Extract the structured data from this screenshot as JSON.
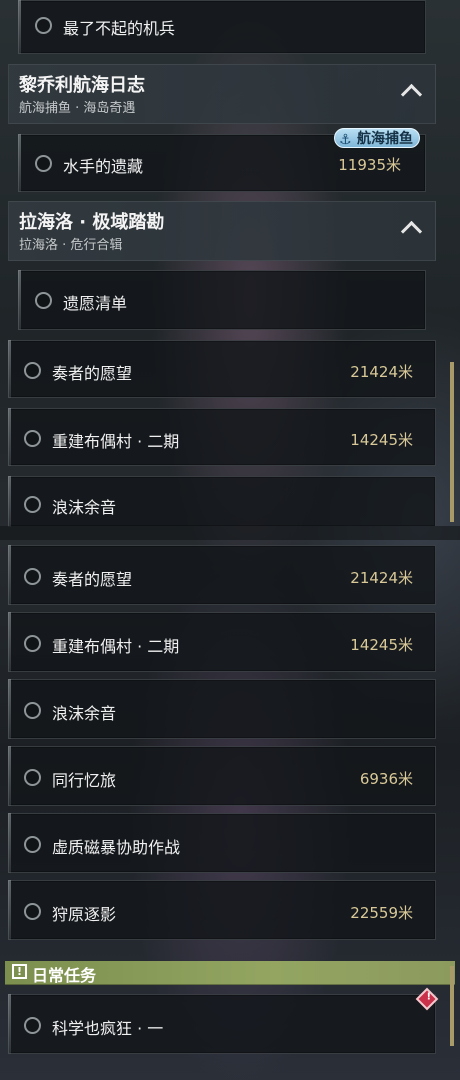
{
  "panel_top": {
    "first_quest": {
      "name": "最了不起的机兵"
    },
    "group1": {
      "title": "黎乔利航海日志",
      "subtitle": "航海捕鱼 · 海岛奇遇"
    },
    "group1_quests": [
      {
        "name": "水手的遗藏",
        "distance": "11935米"
      }
    ],
    "group1_tag": "航海捕鱼",
    "group2": {
      "title": "拉海洛 · 极域踏勘",
      "subtitle": "拉海洛 · 危行合辑"
    },
    "group2_quests": [
      {
        "name": "遗愿清单"
      }
    ],
    "quests": [
      {
        "name": "奏者的愿望",
        "distance": "21424米"
      },
      {
        "name": "重建布偶村 · 二期",
        "distance": "14245米"
      },
      {
        "name": "浪沫余音",
        "distance": ""
      }
    ]
  },
  "panel_bottom": {
    "quests": [
      {
        "name": "奏者的愿望",
        "distance": "21424米"
      },
      {
        "name": "重建布偶村 · 二期",
        "distance": "14245米"
      },
      {
        "name": "浪沫余音",
        "distance": ""
      },
      {
        "name": "同行忆旅",
        "distance": "6936米"
      },
      {
        "name": "虚质磁暴协助作战",
        "distance": ""
      },
      {
        "name": "狩原逐影",
        "distance": "22559米"
      }
    ],
    "daily_section": {
      "label": "日常任务"
    },
    "daily_quests": [
      {
        "name": "科学也疯狂 · 一"
      }
    ]
  },
  "colors": {
    "distance": "#d9c998",
    "daily_bar": "#8c9a5e",
    "alert": "#c9304a",
    "tag": "#9ccbe6"
  }
}
